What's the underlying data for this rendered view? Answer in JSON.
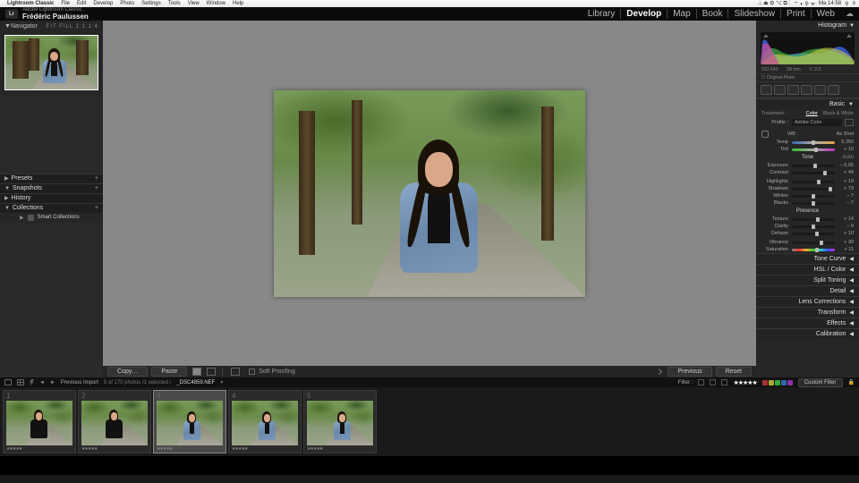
{
  "mac": {
    "app": "Lightroom Classic",
    "menus": [
      "File",
      "Edit",
      "Develop",
      "Photo",
      "Settings",
      "Tools",
      "View",
      "Window",
      "Help"
    ],
    "clock": "Ma 14:58"
  },
  "identity": {
    "product": "Adobe Lightroom Classic",
    "author": "Frédéric Paulussen",
    "modules": [
      "Library",
      "Develop",
      "Map",
      "Book",
      "Slideshow",
      "Print",
      "Web"
    ],
    "active_module": "Develop"
  },
  "left": {
    "navigator": "Navigator",
    "zoom": "FIT  FILL  1:1  1:4",
    "panels": {
      "presets": "Presets",
      "snapshots": "Snapshots",
      "history": "History",
      "collections": "Collections",
      "smart": "Smart Collections"
    }
  },
  "toolbar": {
    "copy": "Copy…",
    "paste": "Paste",
    "softproof": "Soft Proofing",
    "previous": "Previous",
    "reset": "Reset"
  },
  "right": {
    "histogram": "Histogram",
    "meta": {
      "iso": "ISO 640",
      "focal": "58 mm",
      "ap": "f / 2.0",
      "sh": ""
    },
    "orig": "Original Photo",
    "basic": "Basic",
    "treatment": "Treatment :",
    "color": "Color",
    "bw": "Black & White",
    "profile": "Profile :",
    "profile_val": "Adobe Color",
    "wb": "WB :",
    "wb_val": "As Shot",
    "temp": "Temp",
    "temp_v": "5,350",
    "tint": "Tint",
    "tint_v": "+ 10",
    "tone": "Tone",
    "auto": "Auto",
    "exposure": "Exposure",
    "exposure_v": "– 0,05",
    "contrast": "Contrast",
    "contrast_v": "+ 49",
    "highlights": "Highlights",
    "highlights_v": "+ 19",
    "shadows": "Shadows",
    "shadows_v": "+ 79",
    "whites": "Whites",
    "whites_v": "– 7",
    "blacks": "Blacks",
    "blacks_v": "– 7",
    "presence": "Presence",
    "texture": "Texture",
    "texture_v": "+ 14",
    "clarity": "Clarity",
    "clarity_v": "– 9",
    "dehaze": "Dehaze",
    "dehaze_v": "+ 10",
    "vibrance": "Vibrance",
    "vibrance_v": "+ 30",
    "saturation": "Saturation",
    "saturation_v": "+ 11",
    "sections": [
      "Tone Curve",
      "HSL / Color",
      "Split Toning",
      "Detail",
      "Lens Corrections",
      "Transform",
      "Effects",
      "Calibration"
    ]
  },
  "info": {
    "source": "Previous Import",
    "count": "5 of 170 photos /1 selected /",
    "file": "_DSC4859.NEF",
    "filter": "Filter :",
    "custom": "Custom Filter"
  },
  "filmstrip": [
    {
      "n": "1"
    },
    {
      "n": "2"
    },
    {
      "n": "3"
    },
    {
      "n": "4"
    },
    {
      "n": "5"
    }
  ]
}
